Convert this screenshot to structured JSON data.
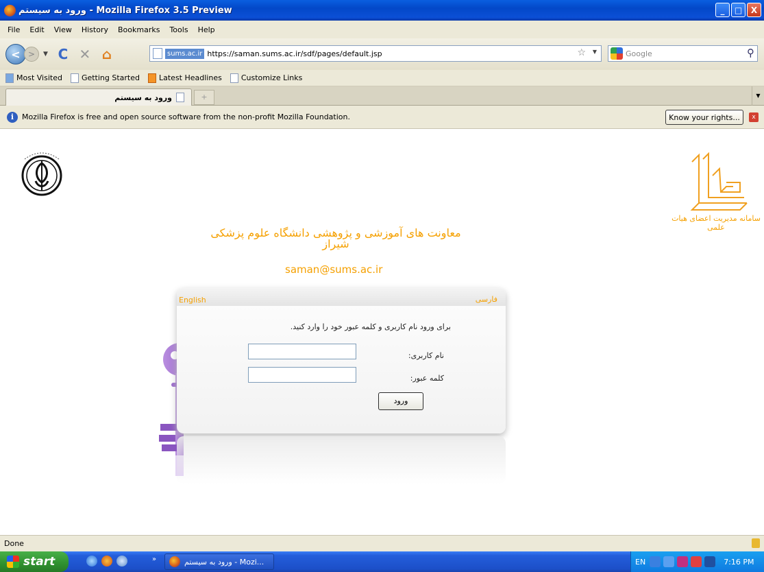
{
  "window": {
    "title": "ورود به سیستم - Mozilla Firefox 3.5 Preview",
    "minimize": "_",
    "maximize": "□",
    "close": "X"
  },
  "menu": {
    "items": [
      "File",
      "Edit",
      "View",
      "History",
      "Bookmarks",
      "Tools",
      "Help"
    ]
  },
  "navbar": {
    "back": "<",
    "forward": ">",
    "reload": "C",
    "stop": "✕",
    "home": "⌂",
    "domain_badge": "sums.ac.ir",
    "url": "https://saman.sums.ac.ir/sdf/pages/default.jsp",
    "search_placeholder": "Google"
  },
  "bookmarks": {
    "items": [
      "Most Visited",
      "Getting Started",
      "Latest Headlines",
      "Customize Links"
    ]
  },
  "tabs": {
    "active_label": "ورود به سیستم",
    "new_tab": "+"
  },
  "notification": {
    "message": "Mozilla Firefox is free and open source software from the non-profit Mozilla Foundation.",
    "button": "Know your rights...",
    "close": "x"
  },
  "page": {
    "saman_caption": "سامانه مدیریت اعضای هیات علمی",
    "headline": "معاونت های آموزشی و پژوهشی دانشگاه علوم پزشکی شیراز",
    "email": "saman@sums.ac.ir",
    "lang_english": "English",
    "lang_farsi": "فارسی",
    "instruction": "برای ورود نام کاربری و کلمه عبور خود را وارد کنید.",
    "username_label": "نام کاربری:",
    "password_label": "کلمه عبور:",
    "username_value": "",
    "password_value": "",
    "login_button": "ورود"
  },
  "status": {
    "text": "Done"
  },
  "taskbar": {
    "start": "start",
    "chevron": "»",
    "task_item": "ورود به سیستم - Mozi...",
    "lang": "EN",
    "clock": "7:16 PM"
  },
  "colors": {
    "accent_orange": "#f5a000",
    "titlebar_blue": "#0348c8",
    "key_purple": "#a070d0"
  }
}
